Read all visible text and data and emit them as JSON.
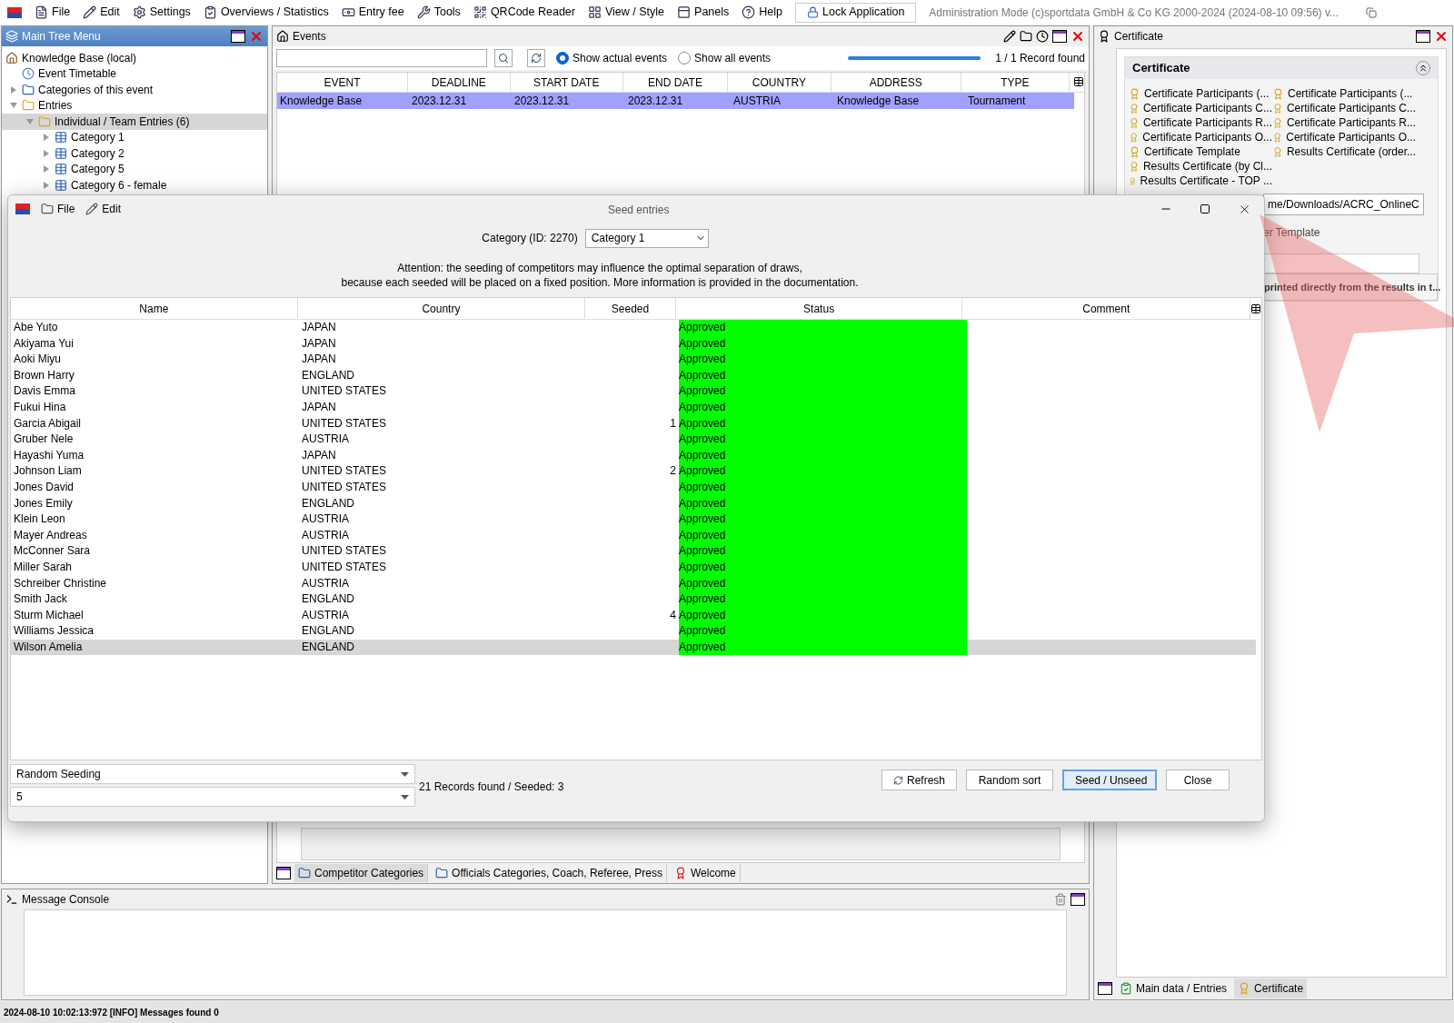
{
  "menu": {
    "items": [
      {
        "label": "File"
      },
      {
        "label": "Edit"
      },
      {
        "label": "Settings"
      },
      {
        "label": "Overviews / Statistics"
      },
      {
        "label": "Entry fee"
      },
      {
        "label": "Tools"
      },
      {
        "label": "QRCode Reader"
      },
      {
        "label": "View / Style"
      },
      {
        "label": "Panels"
      },
      {
        "label": "Help"
      }
    ],
    "lock_button": "Lock Application",
    "app_title": "Administration Mode (c)sportdata GmbH & Co KG 2000-2024 (2024-08-10 09:56)  v..."
  },
  "tree_panel": {
    "title": "Main Tree Menu",
    "tree": [
      {
        "label": "Knowledge Base (local)",
        "children": [
          {
            "label": "Event Timetable"
          },
          {
            "label": "Categories of this event",
            "expanded": false
          },
          {
            "label": "Entries",
            "expanded": true,
            "children": [
              {
                "label": "Individual / Team Entries (6)",
                "expanded": true,
                "selected": true,
                "children": [
                  {
                    "label": "Category 1",
                    "expanded": false
                  },
                  {
                    "label": "Category 2",
                    "expanded": false
                  },
                  {
                    "label": "Category 5",
                    "expanded": false
                  },
                  {
                    "label": "Category 6 - female",
                    "expanded": false
                  }
                ]
              }
            ]
          }
        ]
      }
    ]
  },
  "events_panel": {
    "title": "Events",
    "radios": [
      {
        "label": "Show actual events",
        "selected": true
      },
      {
        "label": "Show all events",
        "selected": false
      }
    ],
    "progress": {
      "level": 1
    },
    "record_count": "1 / 1 Record found",
    "columns": [
      "EVENT",
      "DEADLINE",
      "START DATE",
      "END DATE",
      "COUNTRY",
      "ADDRESS",
      "TYPE"
    ],
    "rows": [
      {
        "cells": [
          "Knowledge Base",
          "2023.12.31",
          "2023.12.31",
          "2023.12.31",
          "AUSTRIA",
          "Knowledge Base",
          "Tournament"
        ],
        "selected": true
      }
    ],
    "bottom_tabs": [
      {
        "label": "Competitor Categories",
        "selected": true
      },
      {
        "label": "Officials Categories, Coach, Referee, Press",
        "selected": false
      },
      {
        "label": "Welcome",
        "selected": false
      }
    ]
  },
  "certificate_panel": {
    "title": "Certificate",
    "section_title": "Certificate",
    "items_left": [
      "Certificate Participants (...",
      "Certificate Participants C...",
      "Certificate Participants R...",
      "Certificate Participants O...",
      "Certificate Template",
      "Results Certificate (by Cl...",
      "Results Certificate - TOP ..."
    ],
    "items_right": [
      "Certificate Participants (...",
      "Certificate Participants C...",
      "Certificate Participants R...",
      "Certificate Participants O...",
      "Results Certificate (order..."
    ],
    "path_value": "me/Downloads/ACRC_OnlineC",
    "template_label": "er Template",
    "note": "printed directly from the results in t...",
    "bottom_tabs": [
      {
        "label": "Main data / Entries",
        "selected": false
      },
      {
        "label": "Certificate",
        "selected": true
      }
    ]
  },
  "console": {
    "title": "Message Console"
  },
  "status_bar": "2024-08-10 10:02:13:972 [INFO] Messages found 0",
  "dialog": {
    "title": "Seed entries",
    "menu": [
      "File",
      "Edit"
    ],
    "category_label": "Category (ID: 2270)",
    "category_value": "Category 1",
    "attention": [
      "Attention: the seeding of competitors may influence the optimal separation of draws,",
      "because each seeded will be placed on a fixed position. More information is provided in the documentation."
    ],
    "columns": [
      "Name",
      "Country",
      "Seeded",
      "Status",
      "Comment"
    ],
    "rows": [
      {
        "name": "Abe Yuto",
        "country": "JAPAN",
        "seeded": "",
        "status": "Approved",
        "selected": false
      },
      {
        "name": "Akiyama Yui",
        "country": "JAPAN",
        "seeded": "",
        "status": "Approved",
        "selected": false
      },
      {
        "name": "Aoki Miyu",
        "country": "JAPAN",
        "seeded": "",
        "status": "Approved",
        "selected": false
      },
      {
        "name": "Brown Harry",
        "country": "ENGLAND",
        "seeded": "",
        "status": "Approved",
        "selected": false
      },
      {
        "name": "Davis Emma",
        "country": "UNITED STATES",
        "seeded": "",
        "status": "Approved",
        "selected": false
      },
      {
        "name": "Fukui Hina",
        "country": "JAPAN",
        "seeded": "",
        "status": "Approved",
        "selected": false
      },
      {
        "name": "Garcia Abigail",
        "country": "UNITED STATES",
        "seeded": "1",
        "status": "Approved",
        "selected": false
      },
      {
        "name": "Gruber Nele",
        "country": "AUSTRIA",
        "seeded": "",
        "status": "Approved",
        "selected": false
      },
      {
        "name": "Hayashi Yuma",
        "country": "JAPAN",
        "seeded": "",
        "status": "Approved",
        "selected": false
      },
      {
        "name": "Johnson Liam",
        "country": "UNITED STATES",
        "seeded": "2",
        "status": "Approved",
        "selected": false
      },
      {
        "name": "Jones David",
        "country": "UNITED STATES",
        "seeded": "",
        "status": "Approved",
        "selected": false
      },
      {
        "name": "Jones Emily",
        "country": "ENGLAND",
        "seeded": "",
        "status": "Approved",
        "selected": false
      },
      {
        "name": "Klein Leon",
        "country": "AUSTRIA",
        "seeded": "",
        "status": "Approved",
        "selected": false
      },
      {
        "name": "Mayer Andreas",
        "country": "AUSTRIA",
        "seeded": "",
        "status": "Approved",
        "selected": false
      },
      {
        "name": "McConner Sara",
        "country": "UNITED STATES",
        "seeded": "",
        "status": "Approved",
        "selected": false
      },
      {
        "name": "Miller Sarah",
        "country": "UNITED STATES",
        "seeded": "",
        "status": "Approved",
        "selected": false
      },
      {
        "name": "Schreiber Christine",
        "country": "AUSTRIA",
        "seeded": "",
        "status": "Approved",
        "selected": false
      },
      {
        "name": "Smith Jack",
        "country": "ENGLAND",
        "seeded": "",
        "status": "Approved",
        "selected": false
      },
      {
        "name": "Sturm Michael",
        "country": "AUSTRIA",
        "seeded": "4",
        "status": "Approved",
        "selected": false
      },
      {
        "name": "Williams Jessica",
        "country": "ENGLAND",
        "seeded": "",
        "status": "Approved",
        "selected": false
      },
      {
        "name": "Wilson Amelia",
        "country": "ENGLAND",
        "seeded": "",
        "status": "Approved",
        "selected": true
      }
    ],
    "selects": [
      "Random Seeding",
      "5"
    ],
    "records": "21 Records found / Seeded: 3",
    "buttons": [
      {
        "label": "Refresh",
        "kind": "icon"
      },
      {
        "label": "Random sort",
        "kind": "plain"
      },
      {
        "label": "Seed / Unseed",
        "kind": "default"
      },
      {
        "label": "Close",
        "kind": "plain"
      }
    ]
  }
}
